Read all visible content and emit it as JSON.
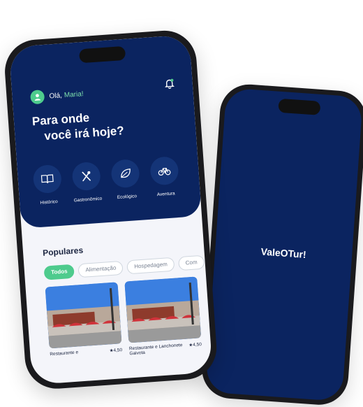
{
  "splash": {
    "logo_text": "ValeOTur!"
  },
  "app": {
    "greeting": "Olá,",
    "user_name": "Maria!",
    "headline_line1": "Para onde",
    "headline_line2": "você irá hoje?"
  },
  "categories": [
    {
      "label": "Histórico",
      "icon": "book-icon"
    },
    {
      "label": "Gastronômico",
      "icon": "utensils-icon"
    },
    {
      "label": "Ecológico",
      "icon": "leaf-icon"
    },
    {
      "label": "Aventura",
      "icon": "bicycle-icon"
    }
  ],
  "popular": {
    "title": "Populares",
    "chips": [
      "Todos",
      "Alimentação",
      "Hospedagem",
      "Com"
    ],
    "cards": [
      {
        "name": "Restaurante e",
        "rating": "★4,50"
      },
      {
        "name": "Restaurante e Lanchonete Gaivota",
        "rating": "★4,50"
      }
    ]
  },
  "colors": {
    "primary": "#0b2460",
    "accent": "#4ecb8d",
    "chip_border": "#cfd6de"
  }
}
